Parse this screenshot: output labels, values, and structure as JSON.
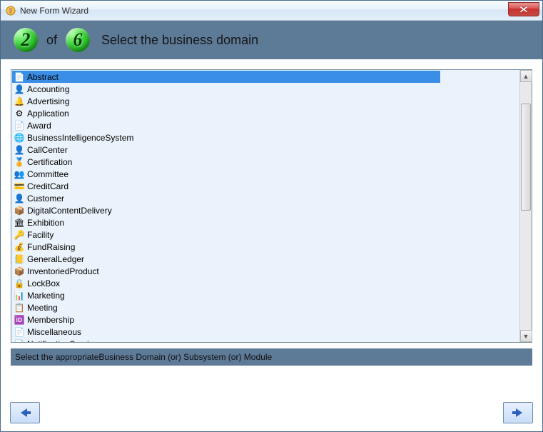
{
  "window": {
    "title": "New Form Wizard"
  },
  "header": {
    "current_step": "2",
    "of_label": "of",
    "total_steps": "6",
    "title": "Select the business domain"
  },
  "list": {
    "selected_index": 0,
    "items": [
      {
        "label": "Abstract",
        "icon": "📄",
        "selected": true
      },
      {
        "label": "Accounting",
        "icon": "👤"
      },
      {
        "label": "Advertising",
        "icon": "🔔"
      },
      {
        "label": "Application",
        "icon": "⚙"
      },
      {
        "label": "Award",
        "icon": "📄"
      },
      {
        "label": "BusinessIntelligenceSystem",
        "icon": "🌐"
      },
      {
        "label": "CallCenter",
        "icon": "👤"
      },
      {
        "label": "Certification",
        "icon": "🏅"
      },
      {
        "label": "Committee",
        "icon": "👥"
      },
      {
        "label": "CreditCard",
        "icon": "💳"
      },
      {
        "label": "Customer",
        "icon": "👤"
      },
      {
        "label": "DigitalContentDelivery",
        "icon": "📦"
      },
      {
        "label": "Exhibition",
        "icon": "🏛"
      },
      {
        "label": "Facility",
        "icon": "🔑"
      },
      {
        "label": "FundRaising",
        "icon": "💰"
      },
      {
        "label": "GeneralLedger",
        "icon": "📒"
      },
      {
        "label": "InventoriedProduct",
        "icon": "📦"
      },
      {
        "label": "LockBox",
        "icon": "🔒"
      },
      {
        "label": "Marketing",
        "icon": "📊"
      },
      {
        "label": "Meeting",
        "icon": "📋"
      },
      {
        "label": "Membership",
        "icon": "🆔"
      },
      {
        "label": "Miscellaneous",
        "icon": "📄"
      },
      {
        "label": "NotificationService",
        "icon": "📄"
      }
    ]
  },
  "hint": "Select the appropriateBusiness Domain (or) Subsystem (or) Module",
  "nav": {
    "prev_tooltip": "Back",
    "next_tooltip": "Next"
  }
}
